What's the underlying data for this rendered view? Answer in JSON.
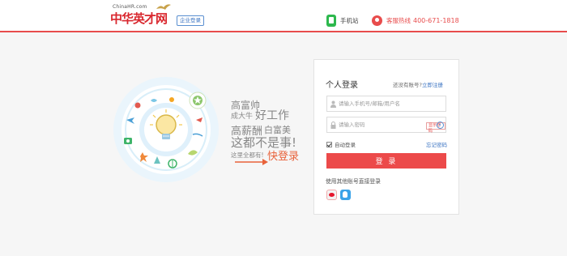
{
  "header": {
    "logo_small": "ChinaHR.com",
    "logo_main": "中华英才网",
    "corp_login": "企业登录",
    "phone_site": "手机站",
    "hotline_label": "客服热线",
    "hotline_number": "400-671-1818"
  },
  "slogan": {
    "line1": "高富帅",
    "line2a": "成大牛",
    "line2b": "好工作",
    "line3a": "高薪酬",
    "line3b": "白富美",
    "line4": "这都不是事!",
    "line5a": "这里全都有!",
    "line5b": "快登录"
  },
  "login": {
    "title": "个人登录",
    "no_account": "还没有账号?",
    "register": "立即注册",
    "username_placeholder": "请输入手机号/邮箱/用户名",
    "password_placeholder": "请输入密码",
    "show_password": "显示密码",
    "auto_login": "自动登录",
    "forgot": "忘记密码",
    "button": "登 录",
    "other_login": "使用其他账号直接登录"
  },
  "icons": {
    "phone": "mobile-phone-icon",
    "hotline": "headset-icon",
    "user": "user-icon",
    "lock": "lock-icon",
    "eye": "eye-icon",
    "weibo": "weibo-icon",
    "qq": "qq-icon"
  },
  "colors": {
    "brand_red": "#d9272e",
    "accent_red": "#ec4a4a",
    "link_blue": "#3a73c2",
    "green": "#2db84d"
  }
}
